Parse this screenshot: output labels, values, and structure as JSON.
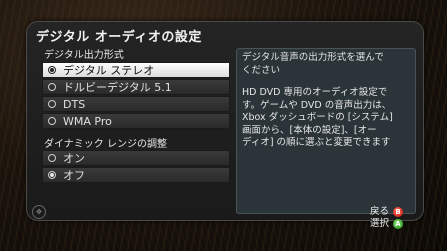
{
  "title": "デジタル オーディオの設定",
  "output_section": {
    "label": "デジタル出力形式",
    "options": [
      {
        "label": "デジタル ステレオ",
        "selected": true
      },
      {
        "label": "ドルビーデジタル 5.1",
        "selected": false
      },
      {
        "label": "DTS",
        "selected": false
      },
      {
        "label": "WMA Pro",
        "selected": false
      }
    ]
  },
  "range_section": {
    "label": "ダイナミック レンジの調整",
    "options": [
      {
        "label": "オン",
        "selected": false
      },
      {
        "label": "オフ",
        "selected": true
      }
    ]
  },
  "description": {
    "intro": "デジタル音声の出力形式を選んで\nください",
    "body": "HD DVD 専用のオーディオ設定で\nす。ゲームや DVD の音声出力は、\nXbox ダッシュボードの [システム]\n画面から、[本体の設定]、[オー\nディオ] の順に選ぶと変更できます"
  },
  "footer": {
    "back_label": "戻る",
    "select_label": "選択",
    "back_button_icon": "b-button-icon",
    "select_button_icon": "a-button-icon"
  },
  "colors": {
    "selected_bg": "#ffffff",
    "panel_bg": "#1e1e1e",
    "desc_bg": "#2b3438",
    "b_button": "#d21f10",
    "a_button": "#2e9b22"
  }
}
